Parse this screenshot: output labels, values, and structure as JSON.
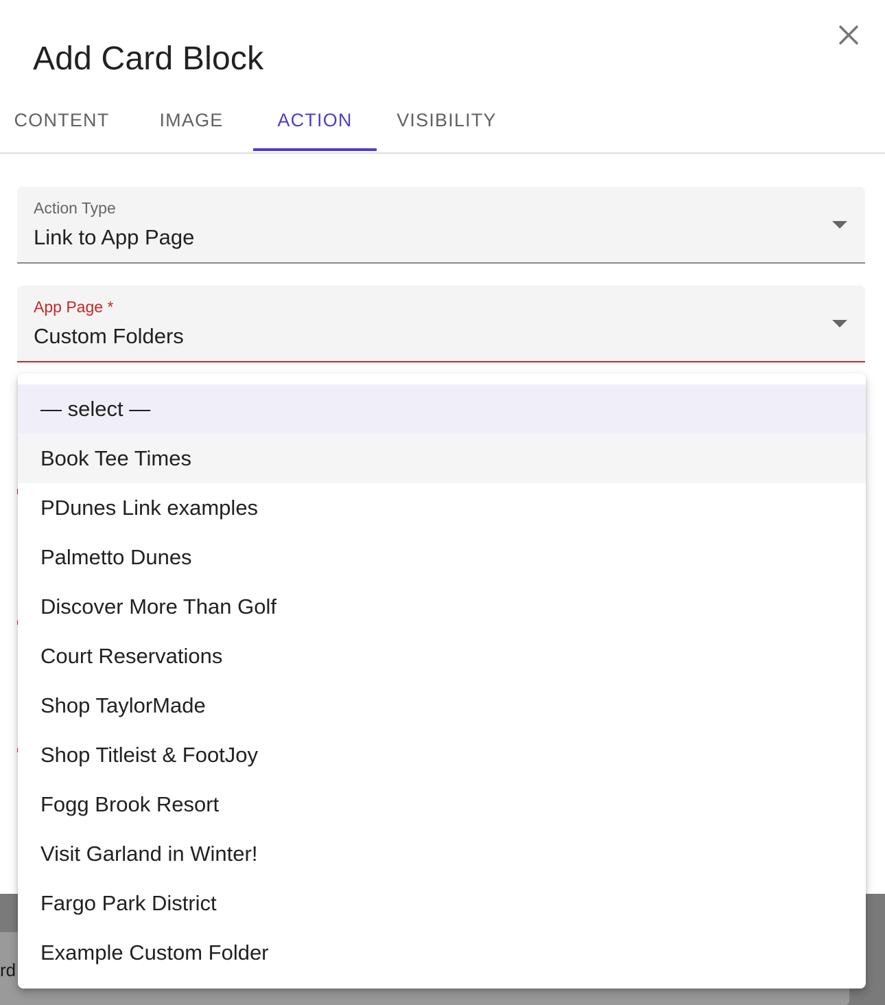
{
  "dialog": {
    "title": "Add Card Block"
  },
  "tabs": [
    {
      "label": "CONTENT",
      "active": false
    },
    {
      "label": "IMAGE",
      "active": false
    },
    {
      "label": "ACTION",
      "active": true
    },
    {
      "label": "VISIBILITY",
      "active": false
    }
  ],
  "fields": {
    "action_type": {
      "label": "Action Type",
      "value": "Link to App Page"
    },
    "app_page": {
      "label": "App Page *",
      "value": "Custom Folders"
    }
  },
  "menu": {
    "options": [
      "— select —",
      "Book Tee Times",
      "PDunes Link examples",
      "Palmetto Dunes",
      "Discover More Than Golf",
      "Court Reservations",
      "Shop TaylorMade",
      "Shop Titleist & FootJoy",
      "Fogg Brook Resort",
      "Visit Garland in Winter!",
      "Fargo Park District",
      "Example Custom Folder"
    ]
  },
  "background": {
    "card_text": "rd"
  },
  "colors": {
    "accent": "#4f3ec9",
    "error": "#c62828",
    "field_bg": "#f4f4f4",
    "selected_option_bg": "#f0eff9"
  },
  "icons": {
    "close": "close-icon",
    "dropdown": "dropdown-caret-icon"
  }
}
